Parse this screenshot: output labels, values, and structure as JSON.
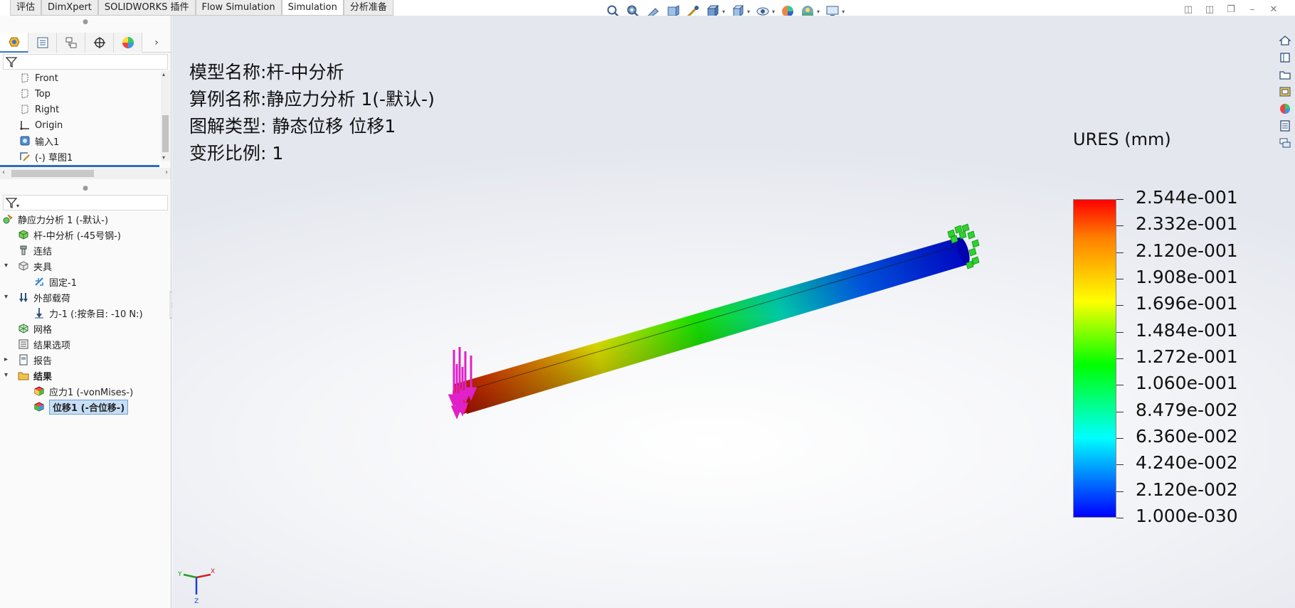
{
  "tabs": [
    {
      "label": "评估",
      "active": false
    },
    {
      "label": "DimXpert",
      "active": false
    },
    {
      "label": "SOLIDWORKS 插件",
      "active": false
    },
    {
      "label": "Flow Simulation",
      "active": false
    },
    {
      "label": "Simulation",
      "active": true
    },
    {
      "label": "分析准备",
      "active": false
    }
  ],
  "hud_icons": [
    "zoom-to-fit-icon",
    "zoom-to-area-icon",
    "previous-view-icon",
    "section-view-icon",
    "dynamic-annotation-icon",
    "view-orientation-icon",
    "display-style-icon",
    "hide-show-icon",
    "edit-appearance-icon",
    "apply-scene-icon",
    "view-settings-icon"
  ],
  "feature_tree": {
    "items": [
      {
        "label": "Front",
        "icon": "plane-icon"
      },
      {
        "label": "Top",
        "icon": "plane-icon"
      },
      {
        "label": "Right",
        "icon": "plane-icon"
      },
      {
        "label": "Origin",
        "icon": "origin-icon"
      },
      {
        "label": "输入1",
        "icon": "imported-body-icon"
      },
      {
        "label": "(-) 草图1",
        "icon": "sketch-icon"
      }
    ]
  },
  "study_tree": {
    "items": [
      {
        "label": "静应力分析 1 (-默认-)",
        "icon": "study-icon",
        "indent": 0,
        "expander": ""
      },
      {
        "label": "杆-中分析 (-45号钢-)",
        "icon": "part-icon",
        "indent": 1,
        "expander": ""
      },
      {
        "label": "连结",
        "icon": "connections-icon",
        "indent": 1,
        "expander": ""
      },
      {
        "label": "夹具",
        "icon": "fixtures-icon",
        "indent": 1,
        "expander": "▾"
      },
      {
        "label": "固定-1",
        "icon": "fixed-geometry-icon",
        "indent": 2,
        "expander": ""
      },
      {
        "label": "外部载荷",
        "icon": "external-loads-icon",
        "indent": 1,
        "expander": "▾"
      },
      {
        "label": "力-1 (:按条目: -10 N:)",
        "icon": "force-icon",
        "indent": 2,
        "expander": ""
      },
      {
        "label": "网格",
        "icon": "mesh-icon",
        "indent": 1,
        "expander": ""
      },
      {
        "label": "结果选项",
        "icon": "result-options-icon",
        "indent": 1,
        "expander": ""
      },
      {
        "label": "报告",
        "icon": "report-icon",
        "indent": 1,
        "expander": "▸"
      },
      {
        "label": "结果",
        "icon": "results-folder-icon",
        "indent": 1,
        "expander": "▾",
        "bold": true
      },
      {
        "label": "应力1 (-vonMises-)",
        "icon": "stress-plot-icon",
        "indent": 2,
        "expander": ""
      },
      {
        "label": "位移1 (-合位移-)",
        "icon": "displacement-plot-icon",
        "indent": 2,
        "expander": "",
        "selected": true
      }
    ]
  },
  "viewport": {
    "model_name": "模型名称:杆-中分析",
    "study_name": "算例名称:静应力分析 1(-默认-)",
    "plot_type": "图解类型: 静态位移 位移1",
    "deform_scale": "变形比例: 1",
    "legend": {
      "title": "URES (mm)",
      "labels": [
        "2.544e-001",
        "2.332e-001",
        "2.120e-001",
        "1.908e-001",
        "1.696e-001",
        "1.484e-001",
        "1.272e-001",
        "1.060e-001",
        "8.479e-002",
        "6.360e-002",
        "4.240e-002",
        "2.120e-002",
        "1.000e-030"
      ]
    },
    "triad": {
      "x": "X",
      "y": "Y",
      "z": "Z"
    }
  },
  "colors": {
    "accent": "#2f6db5",
    "fixture": "#22cc22",
    "load": "#e020c8"
  }
}
